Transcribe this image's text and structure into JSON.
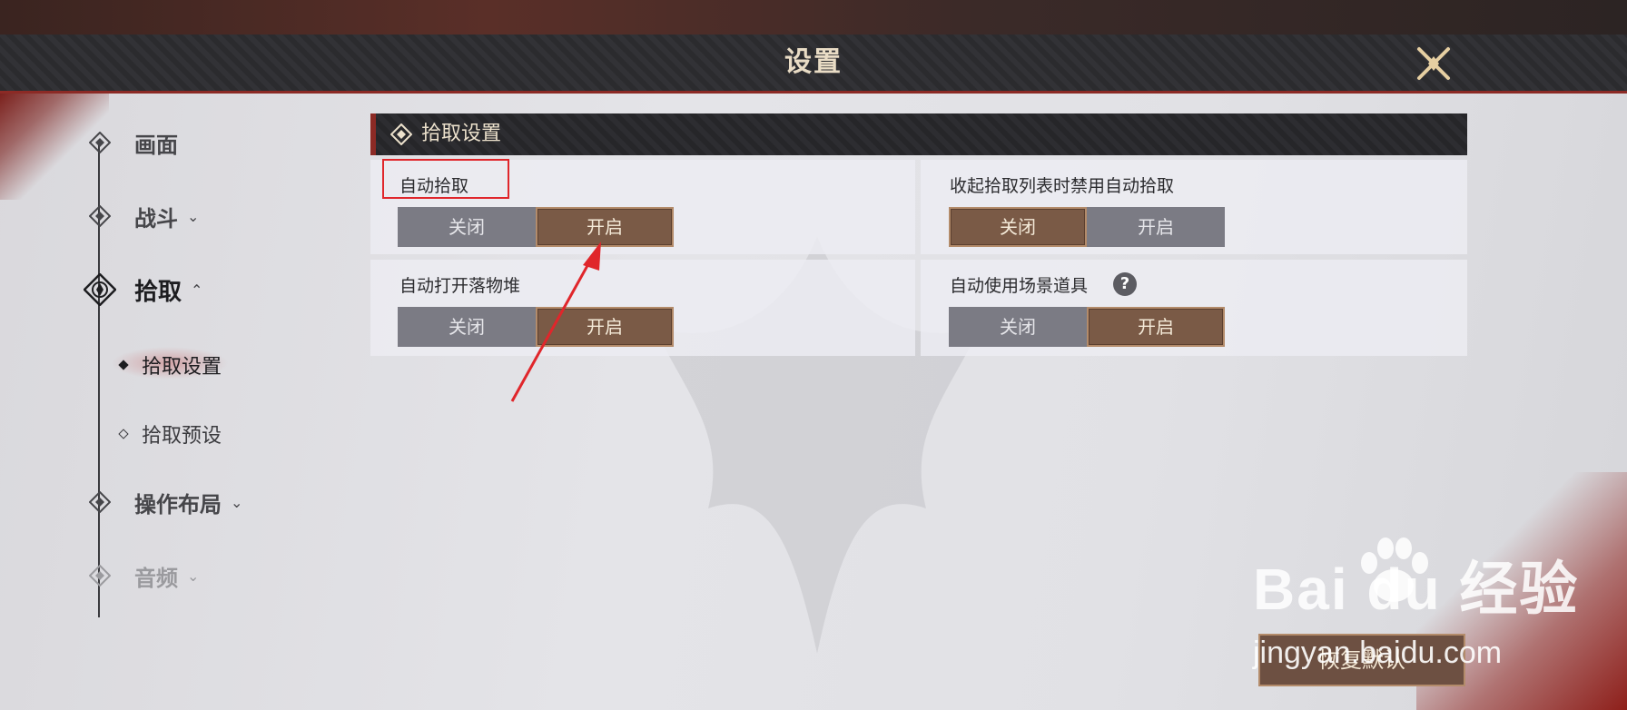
{
  "header": {
    "title": "设置"
  },
  "sidebar": {
    "items": [
      {
        "label": "画面",
        "chevron": ""
      },
      {
        "label": "战斗",
        "chevron": "⌄"
      },
      {
        "label": "拾取",
        "chevron": "⌃"
      },
      {
        "label": "操作布局",
        "chevron": "⌄"
      },
      {
        "label": "音频",
        "chevron": "⌄"
      }
    ],
    "subitems": [
      {
        "label": "拾取设置",
        "active": true
      },
      {
        "label": "拾取预设",
        "active": false
      }
    ]
  },
  "section": {
    "title": "拾取设置"
  },
  "settings": [
    {
      "label": "自动拾取",
      "off": "关闭",
      "on": "开启",
      "selected": "on"
    },
    {
      "label": "收起拾取列表时禁用自动拾取",
      "off": "关闭",
      "on": "开启",
      "selected": "off"
    },
    {
      "label": "自动打开落物堆",
      "off": "关闭",
      "on": "开启",
      "selected": "on"
    },
    {
      "label": "自动使用场景道具",
      "off": "关闭",
      "on": "开启",
      "selected": "on",
      "help": "?"
    }
  ],
  "footer": {
    "restore_label": "恢复默认"
  },
  "watermark": {
    "brand": "Bai du 经验",
    "url": "jingyan.baidu.com"
  },
  "colors": {
    "accent_red": "#8c2a25",
    "toggle_on": "#7a5a46",
    "toggle_off": "#7b7b84",
    "annotation": "#e0262b"
  }
}
